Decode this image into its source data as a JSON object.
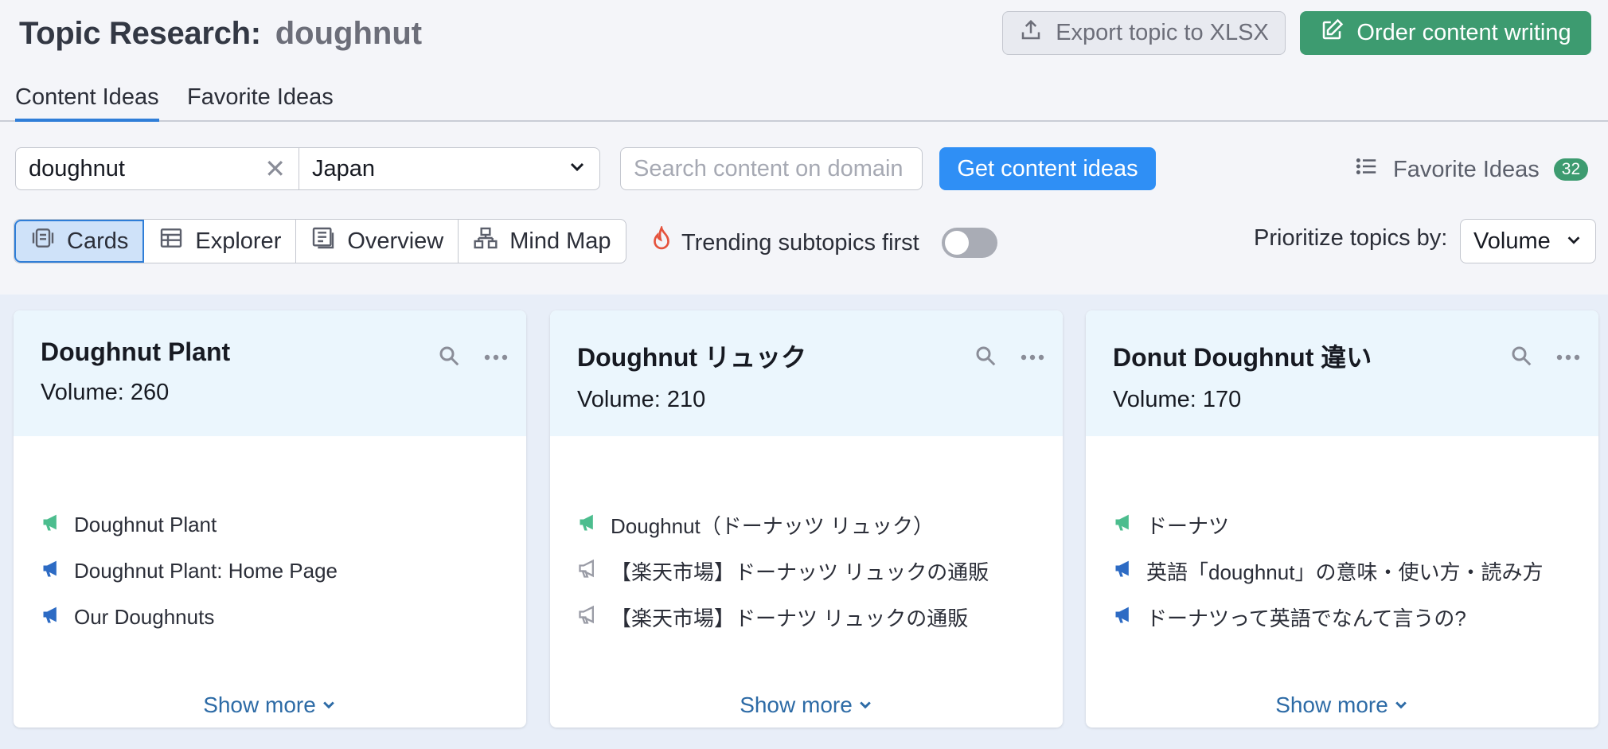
{
  "header": {
    "title": "Topic Research:",
    "keyword": "doughnut",
    "export_label": "Export topic to XLSX",
    "order_label": "Order content writing"
  },
  "tabs": [
    {
      "label": "Content Ideas",
      "active": true
    },
    {
      "label": "Favorite Ideas",
      "active": false
    }
  ],
  "search": {
    "keyword_value": "doughnut",
    "country": "Japan",
    "domain_placeholder": "Search content on domain",
    "get_ideas_label": "Get content ideas"
  },
  "favorites": {
    "label": "Favorite Ideas",
    "count": "32"
  },
  "views": [
    {
      "label": "Cards",
      "icon": "cards-icon",
      "active": true
    },
    {
      "label": "Explorer",
      "icon": "table-icon",
      "active": false
    },
    {
      "label": "Overview",
      "icon": "overview-icon",
      "active": false
    },
    {
      "label": "Mind Map",
      "icon": "mindmap-icon",
      "active": false
    }
  ],
  "trending": {
    "label": "Trending subtopics first",
    "enabled": false
  },
  "prioritize": {
    "label": "Prioritize topics by:",
    "value": "Volume"
  },
  "cards": [
    {
      "title": "Doughnut Plant",
      "volume_label": "Volume:",
      "volume": "260",
      "items": [
        {
          "text": "Doughnut Plant",
          "icon": "megaphone-icon",
          "color": "#4cbd8e"
        },
        {
          "text": "Doughnut Plant: Home Page",
          "icon": "megaphone-icon",
          "color": "#2d6bc4"
        },
        {
          "text": "Our Doughnuts",
          "icon": "megaphone-icon",
          "color": "#2d6bc4"
        }
      ],
      "show_more": "Show more"
    },
    {
      "title": "Doughnut リュック",
      "volume_label": "Volume:",
      "volume": "210",
      "items": [
        {
          "text": "Doughnut（ドーナッツ リュック）",
          "icon": "megaphone-icon",
          "color": "#4cbd8e"
        },
        {
          "text": "【楽天市場】ドーナッツ リュックの通販",
          "icon": "megaphone-outline-icon",
          "color": "#9a9ca6"
        },
        {
          "text": "【楽天市場】ドーナツ リュックの通販",
          "icon": "megaphone-outline-icon",
          "color": "#9a9ca6"
        }
      ],
      "show_more": "Show more"
    },
    {
      "title": "Donut Doughnut 違い",
      "volume_label": "Volume:",
      "volume": "170",
      "items": [
        {
          "text": "ドーナツ",
          "icon": "megaphone-icon",
          "color": "#4cbd8e"
        },
        {
          "text": "英語「doughnut」の意味・使い方・読み方",
          "icon": "megaphone-icon",
          "color": "#2d6bc4"
        },
        {
          "text": "ドーナツって英語でなんて言うの?",
          "icon": "megaphone-icon",
          "color": "#2d6bc4"
        }
      ],
      "show_more": "Show more"
    }
  ]
}
